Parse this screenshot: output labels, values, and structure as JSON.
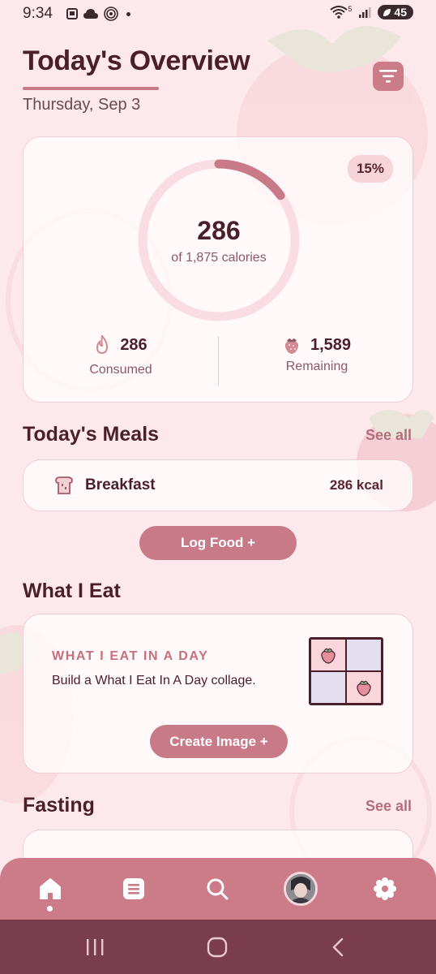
{
  "status_bar": {
    "time": "9:34",
    "network": "5",
    "battery": "45"
  },
  "header": {
    "title": "Today's Overview",
    "date": "Thursday, Sep 3"
  },
  "summary": {
    "percent": "15%",
    "progress_fraction": 0.15,
    "calories": "286",
    "calories_sub": "of 1,875 calories",
    "consumed_value": "286",
    "consumed_label": "Consumed",
    "remaining_value": "1,589",
    "remaining_label": "Remaining"
  },
  "meals": {
    "title": "Today's Meals",
    "see_all": "See all",
    "items": [
      {
        "name": "Breakfast",
        "kcal": "286 kcal",
        "icon": "toast-icon"
      }
    ],
    "log_button": "Log Food +"
  },
  "what_i_eat": {
    "title": "What I Eat",
    "card_heading": "WHAT I EAT IN A DAY",
    "card_desc": "Build a What I Eat In A Day collage.",
    "button": "Create Image +"
  },
  "fasting": {
    "title": "Fasting",
    "see_all": "See all"
  },
  "bottom_nav": {
    "items": [
      "home-icon",
      "list-icon",
      "search-icon",
      "avatar",
      "settings-icon"
    ],
    "active": "home-icon"
  },
  "system_nav": [
    "recents-icon",
    "home-circle-icon",
    "back-icon"
  ],
  "colors": {
    "accent": "#c97a88",
    "background": "#fde9ec",
    "text_dark": "#4a1f2a",
    "nav_bar": "#cc7b89",
    "system_bar": "#7a3d4f"
  }
}
